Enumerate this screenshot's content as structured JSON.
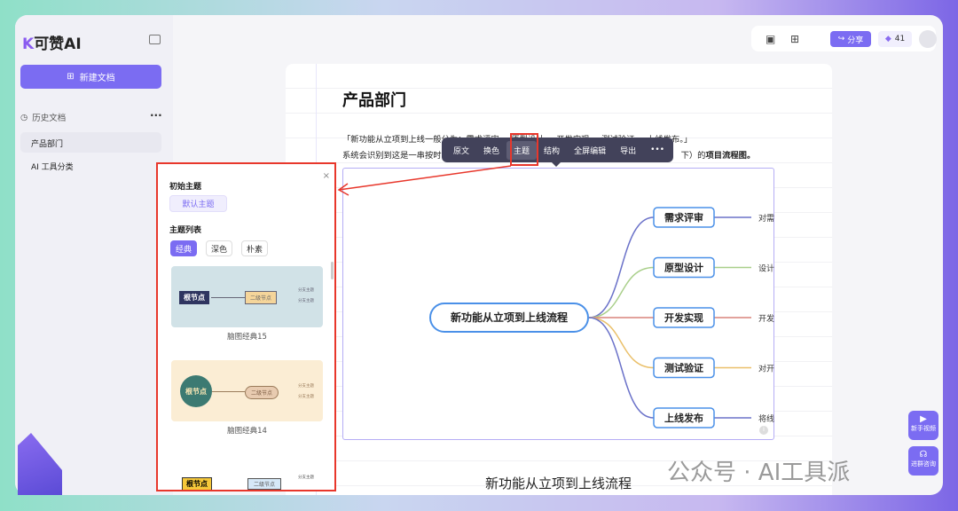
{
  "app": {
    "logo": "可赞AI",
    "new_doc": "新建文档",
    "history": "历史文档",
    "history_items": [
      "产品部门",
      "AI 工具分类"
    ]
  },
  "topbar": {
    "share": "分享",
    "credits": "41"
  },
  "doc": {
    "title": "产品部门",
    "para1": "「新功能从立项到上线一般分为：需求评审 → 原型设计 → 开发实现 → 测试验证 → 上线发布。」",
    "para2_a": "系统会识别到这是一串按时",
    "para2_b": "下）的",
    "para2_bold": "项目流程图。",
    "bottom_caption": "新功能从立项到上线流程"
  },
  "toolbar": {
    "items": [
      "原文",
      "换色",
      "主题",
      "结构",
      "全屏编辑",
      "导出",
      "•••"
    ],
    "active": "主题"
  },
  "mindmap": {
    "root": "新功能从立项到上线流程",
    "branches": [
      {
        "label": "需求评审",
        "leaf": "对需",
        "color": "#6b72c9"
      },
      {
        "label": "原型设计",
        "leaf": "设计",
        "color": "#a9cf8a"
      },
      {
        "label": "开发实现",
        "leaf": "开发",
        "color": "#d9837c"
      },
      {
        "label": "测试验证",
        "leaf": "对开",
        "color": "#eac06a"
      },
      {
        "label": "上线发布",
        "leaf": "将线",
        "color": "#6b72c9"
      }
    ]
  },
  "theme_panel": {
    "initial_title": "初始主题",
    "default_theme": "默认主题",
    "list_title": "主题列表",
    "tabs": [
      "经典",
      "深色",
      "朴素"
    ],
    "active_tab": "经典",
    "themes": [
      {
        "name": "脑图经典15",
        "root": "根节点",
        "second": "二级节点",
        "branch": "分支主题"
      },
      {
        "name": "脑图经典14",
        "root": "根节点",
        "second": "二级节点",
        "branch": "分支主题"
      },
      {
        "name": "",
        "root": "根节点",
        "second": "二级节点",
        "branch": "分支主题"
      }
    ]
  },
  "float": {
    "video": "新手视频",
    "consult": "进群咨询"
  },
  "watermark": "公众号 · AI工具派"
}
